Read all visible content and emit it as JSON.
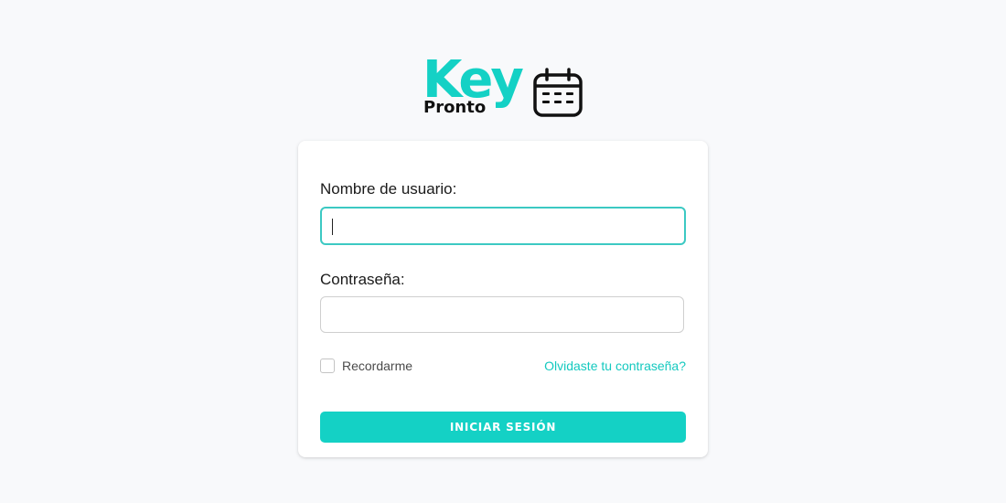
{
  "logo": {
    "word_main": "Key",
    "word_sub": "Pronto",
    "accent_color": "#14d1c5",
    "icon": "calendar-icon"
  },
  "form": {
    "username_label": "Nombre de usuario:",
    "username_value": "",
    "password_label": "Contraseña:",
    "password_value": "",
    "remember_label": "Recordarme",
    "remember_checked": false,
    "forgot_link": "Olvidaste tu contraseña?",
    "submit_label": "INICIAR SESIÓN"
  },
  "colors": {
    "accent": "#14d1c5",
    "focus_border": "#3cc9c3",
    "background": "#f8f9fb"
  }
}
